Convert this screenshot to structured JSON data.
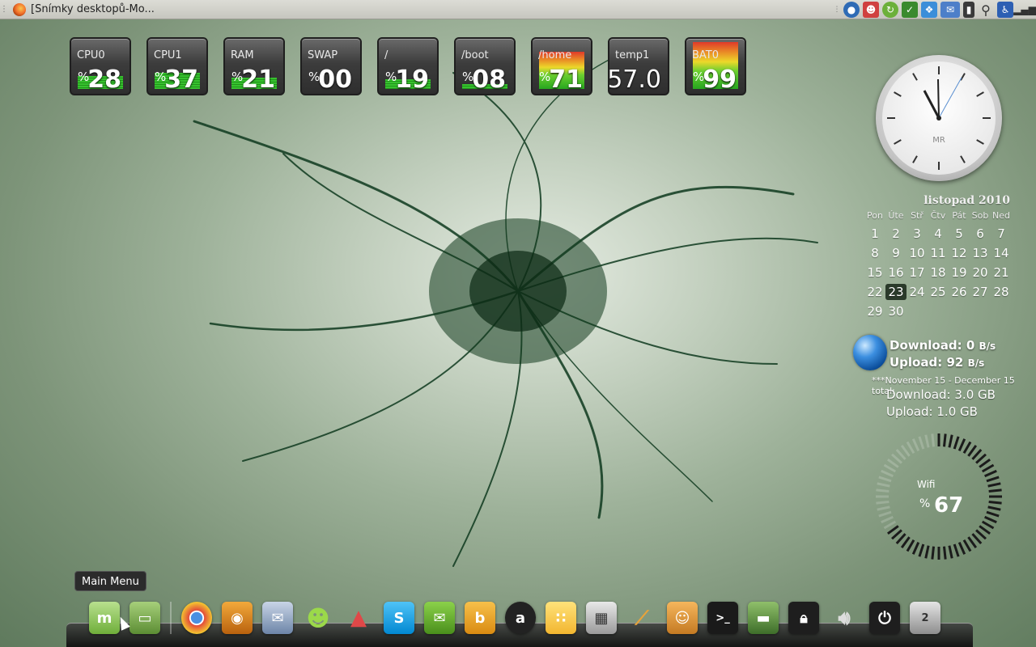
{
  "top_panel": {
    "window_title": "[Snímky desktopů-Mo...",
    "tray_icons": [
      "network-manager-icon",
      "user-icon",
      "update-icon",
      "shield-icon",
      "dropbox-icon",
      "mail-icon",
      "battery-icon",
      "search-icon",
      "accessibility-icon",
      "signal-icon"
    ]
  },
  "sysmon": [
    {
      "label": "CPU0",
      "pct": "%",
      "value": "28"
    },
    {
      "label": "CPU1",
      "pct": "%",
      "value": "37"
    },
    {
      "label": "RAM",
      "pct": "%",
      "value": "21"
    },
    {
      "label": "SWAP",
      "pct": "%",
      "value": "00"
    },
    {
      "label": "/",
      "pct": "%",
      "value": "19"
    },
    {
      "label": "/boot",
      "pct": "%",
      "value": "08"
    },
    {
      "label": "/home",
      "pct": "%",
      "value": "71"
    },
    {
      "label": "temp1",
      "pct": "",
      "value": "57.0"
    },
    {
      "label": "BAT0",
      "pct": "%",
      "value": "99"
    }
  ],
  "clock": {
    "brand": "MR"
  },
  "calendar": {
    "title": "listopad 2010",
    "weekdays": [
      "Pon",
      "Úte",
      "Stř",
      "Čtv",
      "Pát",
      "Sob",
      "Ned"
    ],
    "days": [
      "1",
      "2",
      "3",
      "4",
      "5",
      "6",
      "7",
      "8",
      "9",
      "10",
      "11",
      "12",
      "13",
      "14",
      "15",
      "16",
      "17",
      "18",
      "19",
      "20",
      "21",
      "22",
      "23",
      "24",
      "25",
      "26",
      "27",
      "28",
      "29",
      "30"
    ],
    "today": "23"
  },
  "network": {
    "download_label": "Download: 0",
    "download_unit": "B/s",
    "upload_label": "Upload: 92",
    "upload_unit": "B/s",
    "period": "***November 15 - December 15 total:",
    "total_download": "Download: 3.0 GB",
    "total_upload": "Upload: 1.0 GB"
  },
  "wifi": {
    "label": "Wifi",
    "pct": "%",
    "value": "67"
  },
  "tooltip": {
    "text": "Main Menu"
  },
  "dock": {
    "items": [
      "mint-menu-icon",
      "folder-icon",
      "chrome-icon",
      "media-player-icon",
      "email-client-icon",
      "messenger-icon",
      "rocket-icon",
      "skype-icon",
      "sms-icon",
      "bibble-icon",
      "amarok-icon",
      "cheese-icon",
      "calculator-icon",
      "magic-wand-icon",
      "cat-icon",
      "terminal-icon",
      "desktop-icon",
      "lock-icon",
      "volume-icon",
      "power-icon",
      "trash-icon"
    ],
    "trash_count": "2",
    "terminal_glyph": ">_"
  },
  "colors": {
    "accent": "#36c22e",
    "panel": "#d4d4ce",
    "dock": "#1e1e1e"
  }
}
